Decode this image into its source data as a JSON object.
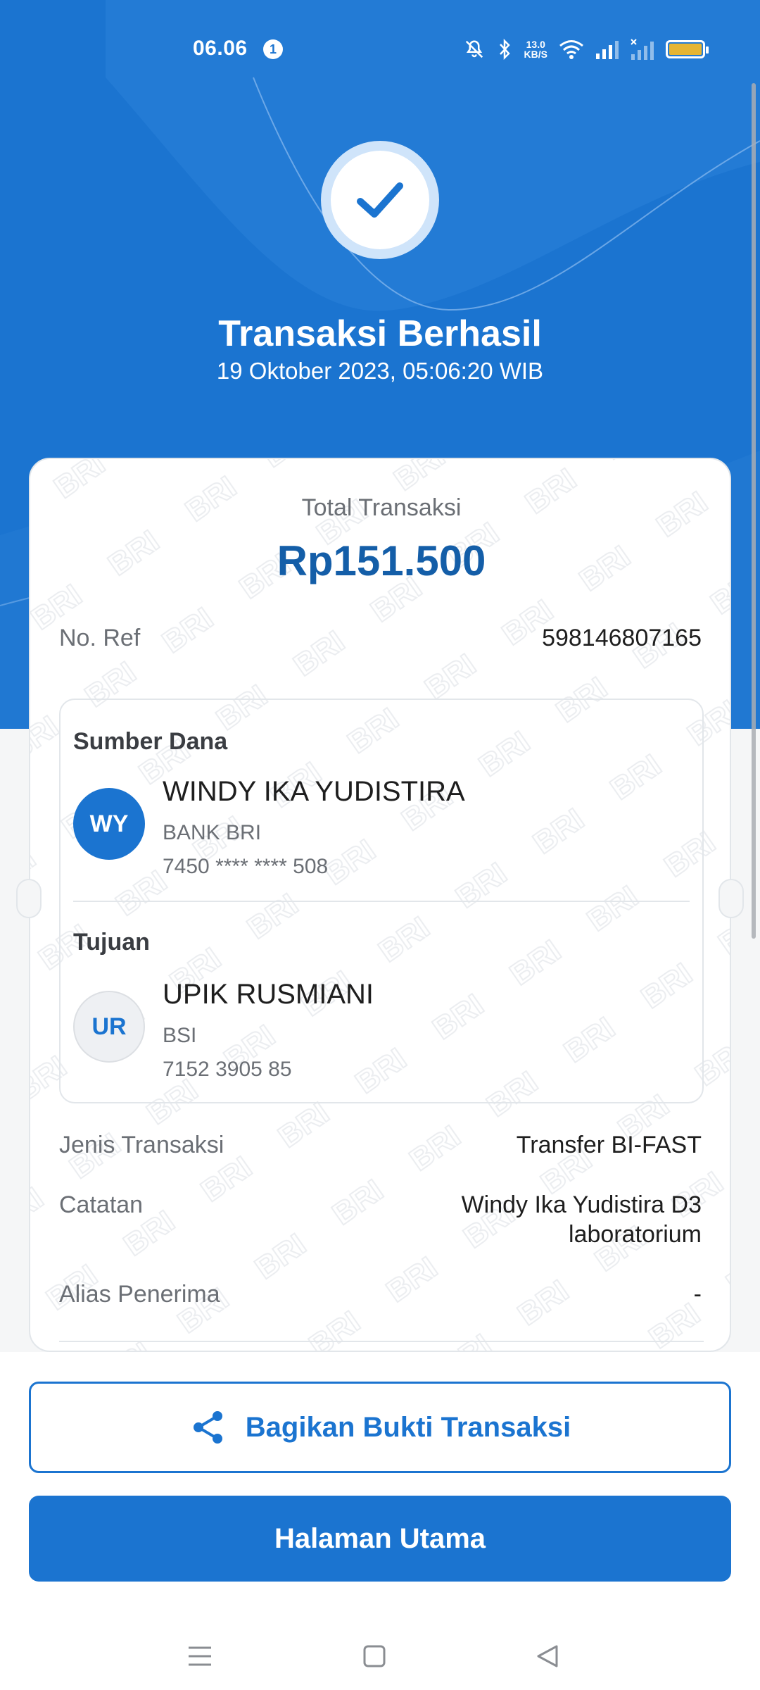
{
  "status_bar": {
    "time": "06.06",
    "notification_count": "1",
    "net_speed_value": "13.0",
    "net_speed_unit": "KB/S",
    "icons": [
      "bell-muted-icon",
      "bluetooth-icon",
      "wifi-icon",
      "signal-icon",
      "signal-off-icon",
      "battery-icon"
    ]
  },
  "header": {
    "icon": "check-icon",
    "title": "Transaksi Berhasil",
    "datetime": "19 Oktober 2023, 05:06:20 WIB"
  },
  "summary": {
    "total_label": "Total Transaksi",
    "total_amount": "Rp151.500",
    "ref_label": "No. Ref",
    "ref_value": "598146807165"
  },
  "source": {
    "section_title": "Sumber Dana",
    "initials": "WY",
    "name": "WINDY IKA YUDISTIRA",
    "bank": "BANK BRI",
    "account": "7450 **** **** 508"
  },
  "destination": {
    "section_title": "Tujuan",
    "initials": "UR",
    "name": "UPIK RUSMIANI",
    "bank": "BSI",
    "account": "7152 3905 85"
  },
  "details": {
    "type_label": "Jenis Transaksi",
    "type_value": "Transfer BI-FAST",
    "note_label": "Catatan",
    "note_line1": "Windy Ika Yudistira D3",
    "note_line2": "laboratorium",
    "alias_label": "Alias Penerima",
    "alias_value": "-"
  },
  "watermark": "BRI",
  "actions": {
    "share_label": "Bagikan Bukti Transaksi",
    "share_icon": "share-icon",
    "home_label": "Halaman Utama"
  },
  "colors": {
    "primary": "#1b74d0",
    "amount": "#145ea8",
    "battery": "#e6b533"
  }
}
